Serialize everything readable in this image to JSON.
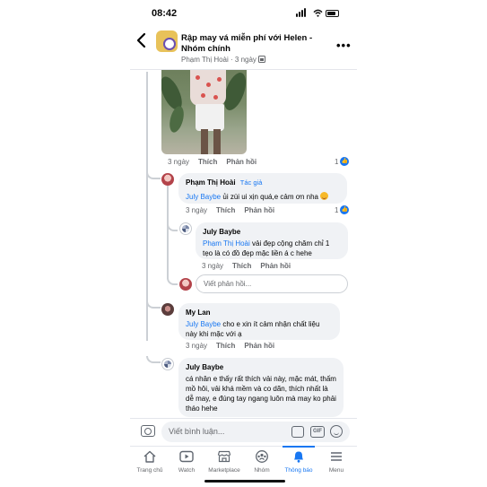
{
  "status_bar": {
    "time": "08:42"
  },
  "header": {
    "title": "Rập may vá miễn phí với Helen - Nhóm chính",
    "author": "Phạm Thị Hoài",
    "time": "3 ngày",
    "separator": "·"
  },
  "photo_comment": {
    "time": "3 ngày",
    "like_label": "Thích",
    "reply_label": "Phản hồi",
    "like_count": "1"
  },
  "comments": [
    {
      "name": "Phạm Thị Hoài",
      "badge": "Tác giả",
      "mention": "July Baybe",
      "text": " ủi zùi ui xịn quá,e cảm ơn nha",
      "time": "3 ngày",
      "like_label": "Thích",
      "reply_label": "Phản hồi",
      "like_count": "1"
    },
    {
      "name": "July Baybe",
      "mention": "Phạm Thị Hoài",
      "text": " vải đẹp cộng chăm chỉ 1 tẹo là có đồ đẹp mặc liền á c hehe",
      "time": "3 ngày",
      "like_label": "Thích",
      "reply_label": "Phản hồi"
    },
    {
      "name": "My Lan",
      "mention": "July Baybe",
      "text": " cho e xin ít cảm nhận chất liệu này khi mặc với ạ",
      "time": "3 ngày",
      "like_label": "Thích",
      "reply_label": "Phản hồi"
    },
    {
      "name": "July Baybe",
      "text": "cá nhân e thấy rất thích vải này, mặc mát, thấm mồ hôi, vải khá mềm và co dãn, thích nhất là dễ may, e đúng tay ngang luôn mà may ko phải tháo hehe"
    }
  ],
  "reply_input": {
    "placeholder": "Viết phản hồi..."
  },
  "composer": {
    "placeholder": "Viết bình luận...",
    "gif_label": "GIF"
  },
  "tabs": [
    {
      "label": "Trang chủ",
      "icon": "home-icon"
    },
    {
      "label": "Watch",
      "icon": "watch-icon"
    },
    {
      "label": "Marketplace",
      "icon": "marketplace-icon"
    },
    {
      "label": "Nhóm",
      "icon": "groups-icon"
    },
    {
      "label": "Thông báo",
      "icon": "bell-icon",
      "active": true
    },
    {
      "label": "Menu",
      "icon": "menu-icon"
    }
  ],
  "colors": {
    "accent": "#1877f2",
    "bubble": "#f0f2f5",
    "secondary_text": "#65676b"
  }
}
